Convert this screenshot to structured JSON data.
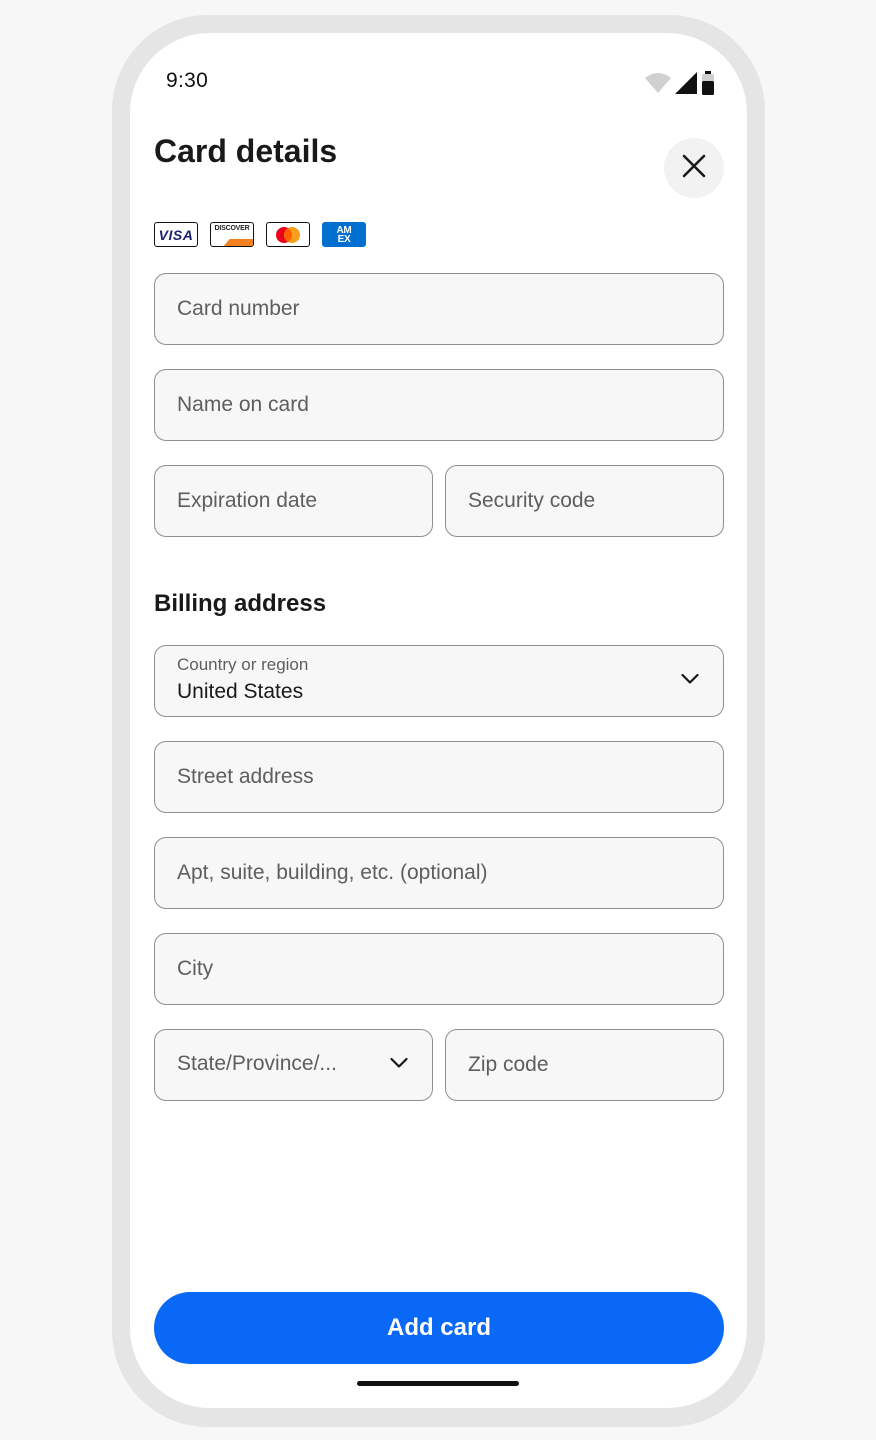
{
  "status_bar": {
    "time": "9:30",
    "icons": [
      "wifi-icon",
      "signal-icon",
      "battery-icon"
    ]
  },
  "header": {
    "title": "Card details",
    "close_icon": "close-icon"
  },
  "card_brands": {
    "visa": "VISA",
    "discover": "DISCOVER",
    "mastercard": "mastercard-logo",
    "amex_line1": "AM",
    "amex_line2": "EX"
  },
  "card_form": {
    "card_number_placeholder": "Card number",
    "name_placeholder": "Name on card",
    "expiration_placeholder": "Expiration date",
    "security_placeholder": "Security code"
  },
  "billing": {
    "title": "Billing address",
    "country_label": "Country or region",
    "country_value": "United States",
    "street_placeholder": "Street address",
    "apt_placeholder": "Apt, suite, building, etc. (optional)",
    "city_placeholder": "City",
    "state_placeholder": "State/Province/...",
    "zip_placeholder": "Zip code"
  },
  "actions": {
    "add_card_label": "Add card"
  },
  "colors": {
    "primary": "#0968f6",
    "field_bg": "#f7f7f7",
    "field_border": "#8f8f8f",
    "text": "#191919"
  }
}
